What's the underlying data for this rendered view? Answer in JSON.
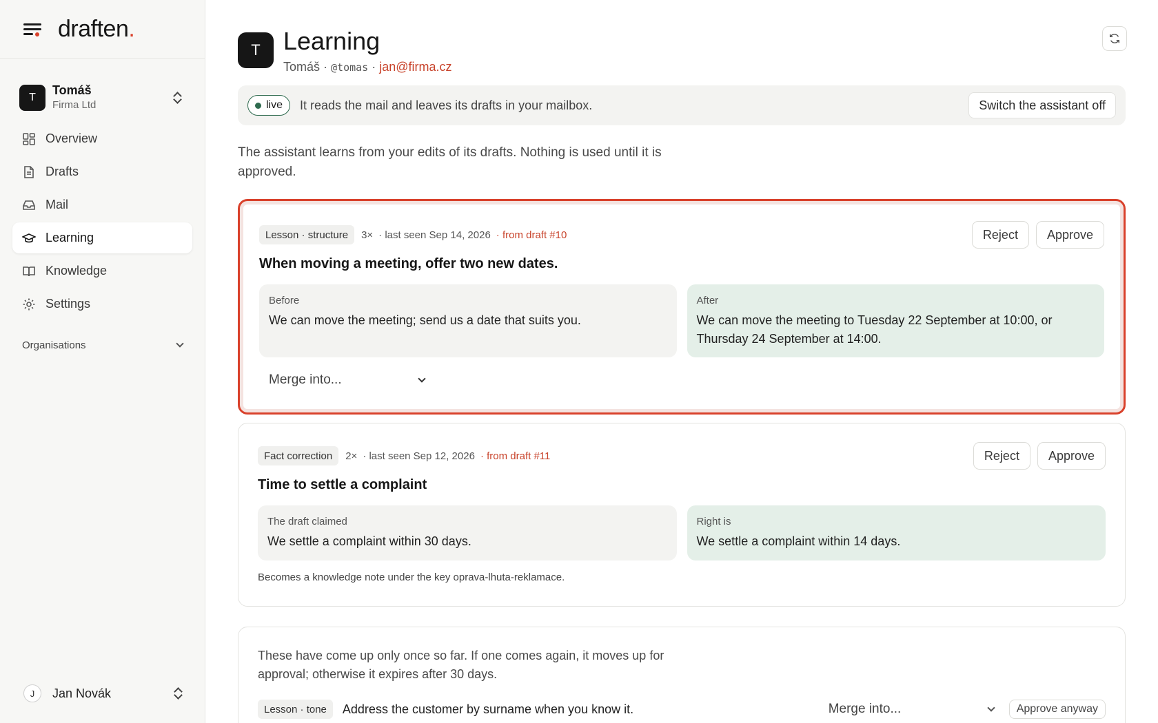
{
  "brand": {
    "name": "draften",
    "dot": "."
  },
  "account": {
    "initial": "T",
    "name": "Tomáš",
    "org": "Firma Ltd"
  },
  "nav": [
    {
      "label": "Overview",
      "icon": "grid-icon"
    },
    {
      "label": "Drafts",
      "icon": "document-icon"
    },
    {
      "label": "Mail",
      "icon": "inbox-icon"
    },
    {
      "label": "Learning",
      "icon": "graduation-cap-icon",
      "active": true
    },
    {
      "label": "Knowledge",
      "icon": "book-icon"
    },
    {
      "label": "Settings",
      "icon": "gear-icon"
    }
  ],
  "organisations_label": "Organisations",
  "user": {
    "initial": "J",
    "name": "Jan Novák"
  },
  "header": {
    "initial": "T",
    "title": "Learning",
    "name": "Tomáš",
    "separator": " · ",
    "handle": "@tomas",
    "email": "jan@firma.cz"
  },
  "status": {
    "badge": "live",
    "text": "It reads the mail and leaves its drafts in your mailbox.",
    "switch_label": "Switch the assistant off"
  },
  "intro": "The assistant learns from your edits of its drafts. Nothing is used until it is approved.",
  "cards": [
    {
      "tag": "Lesson · structure",
      "count": "3×",
      "last_seen": "· last seen Sep 14, 2026",
      "source": "· from draft #10",
      "title": "When moving a meeting, offer two new dates.",
      "left_label": "Before",
      "left_text": "We can move the meeting; send us a date that suits you.",
      "right_label": "After",
      "right_text": "We can move the meeting to Tuesday 22 September at 10:00, or Thursday 24 September at 14:00.",
      "merge_label": "Merge into...",
      "reject_label": "Reject",
      "approve_label": "Approve"
    },
    {
      "tag": "Fact correction",
      "count": "2×",
      "last_seen": "· last seen Sep 12, 2026",
      "source": "· from draft #11",
      "title": "Time to settle a complaint",
      "left_label": "The draft claimed",
      "left_text": "We settle a complaint within 30 days.",
      "right_label": "Right is",
      "right_text": "We settle a complaint within 14 days.",
      "note": "Becomes a knowledge note under the key oprava-lhuta-reklamace.",
      "reject_label": "Reject",
      "approve_label": "Approve"
    }
  ],
  "once": {
    "text": "These have come up only once so far. If one comes again, it moves up for approval; otherwise it expires after 30 days.",
    "items": [
      {
        "tag": "Lesson · tone",
        "text": "Address the customer by surname when you know it.",
        "merge_label": "Merge into...",
        "approve_label": "Approve anyway"
      }
    ]
  },
  "colors": {
    "accent": "#d9412b",
    "live": "#2f6b4f",
    "after_bg": "#e4efe8",
    "sidebar_bg": "#f7f7f5"
  }
}
